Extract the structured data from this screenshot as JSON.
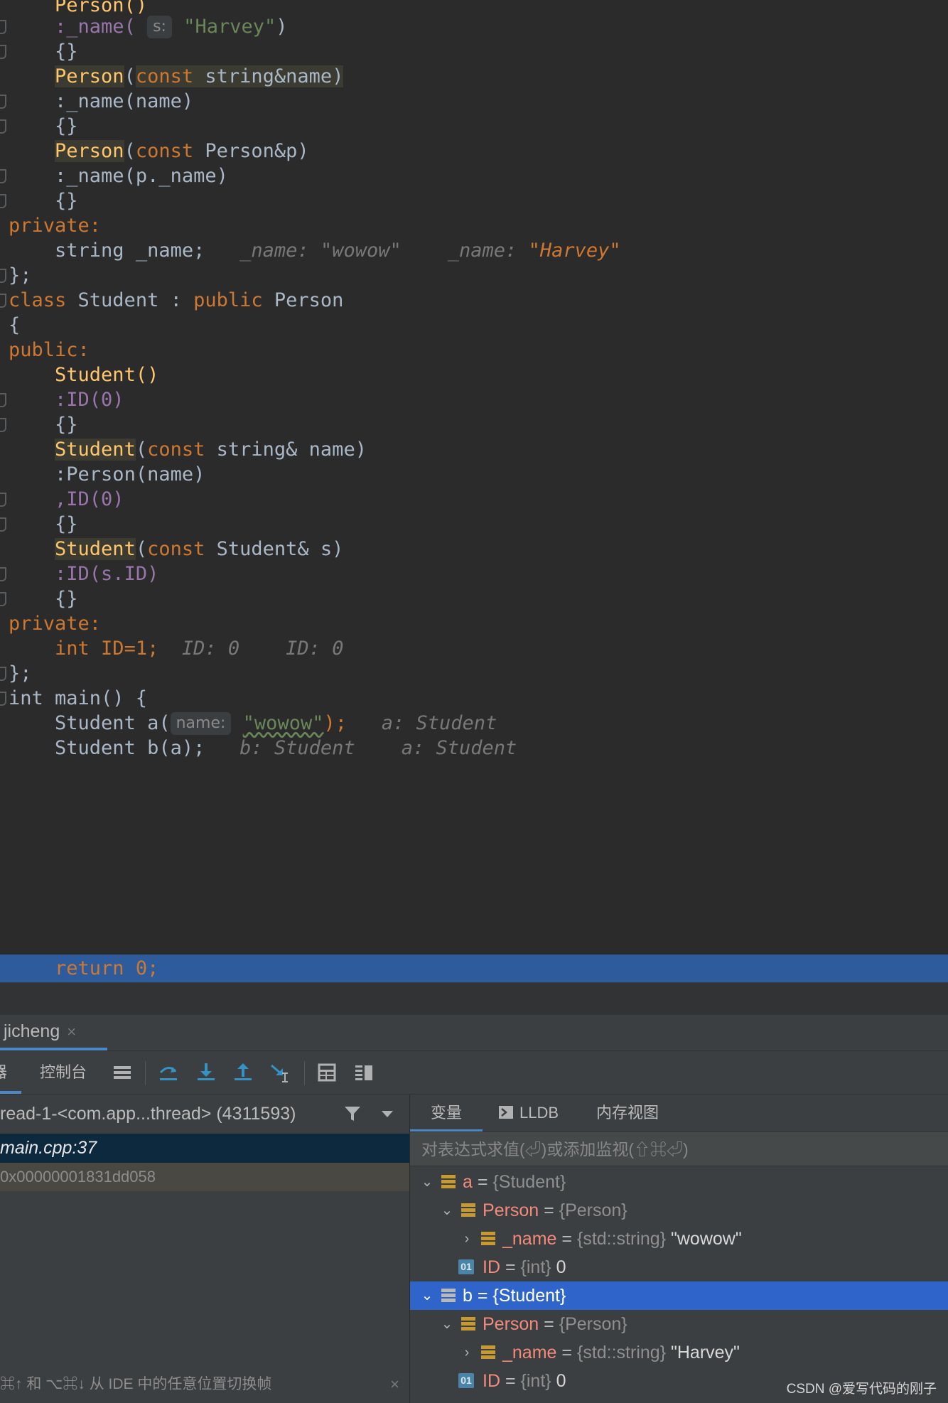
{
  "editor": {
    "l1": "Person()",
    "l2_pre": ":_name(",
    "l2_hint": "s:",
    "l2_str": "\"Harvey\"",
    "l2_post": ")",
    "braces": "{}",
    "l4_fn": "Person",
    "l4_rest_kw": "const",
    "l4_rest": " string&name)",
    "l5": ":_name(name)",
    "l7_fn": "Person",
    "l7_kw": "const",
    "l7_rest": " Person&p)",
    "l8": ":_name(p._name)",
    "private_label": "private:",
    "l11_code": "string _name;",
    "l11_inl1_label": "_name:",
    "l11_inl1_val": "\"wowow\"",
    "l11_inl2_label": "_name:",
    "l11_inl2_val": "\"Harvey\"",
    "close_class": "};",
    "l13_kw1": "class",
    "l13_name": " Student : ",
    "l13_kw2": "public",
    "l13_base": " Person",
    "l14": "{",
    "public_label": "public:",
    "l16": "Student()",
    "l17": ":ID(0)",
    "l19_fn": "Student",
    "l19_kw": "const",
    "l19_rest": " string& name)",
    "l20": ":Person(name)",
    "l21": ",ID(0)",
    "l23_fn": "Student",
    "l23_kw": "const",
    "l23_rest": " Student& s)",
    "l24": ":ID(s.ID)",
    "l27_code": "int ID=1;",
    "l27_inl1": "ID: 0",
    "l27_inl2": "ID: 0",
    "l29": "int main() {",
    "l30_pre": "Student a(",
    "l30_hint": "name:",
    "l30_str": "\"wowow\"",
    "l30_post": ");",
    "l30_inl": "a: Student",
    "l31_code": "Student b(a);",
    "l31_inl1": "b: Student",
    "l31_inl2": "a: Student",
    "l32": "return 0;"
  },
  "debug_tab": {
    "label": "jicheng",
    "close": "×"
  },
  "toolbar": {
    "left_label": "器",
    "console_label": "控制台"
  },
  "frames": {
    "thread": "read-1-<com.app...thread> (4311593)",
    "frame1": "main.cpp:37",
    "frame2": "0x00000001831dd058",
    "hint": "⌘↑ 和 ⌥⌘↓ 从 IDE 中的任意位置切换帧",
    "hint_close": "×"
  },
  "vars_panel": {
    "tabs": [
      "变量",
      "LLDB",
      "内存视图"
    ],
    "eval_placeholder": "对表达式求值(⏎)或添加监视(⇧⌘⏎)",
    "rows": [
      {
        "name": "a",
        "type": "{Student}",
        "value": ""
      },
      {
        "name": "Person",
        "type": "{Person}",
        "value": ""
      },
      {
        "name": "_name",
        "type": "{std::string}",
        "value": "\"wowow\""
      },
      {
        "name": "ID",
        "type": "{int}",
        "value": "0"
      },
      {
        "name": "b",
        "type": "{Student}",
        "value": ""
      },
      {
        "name": "Person",
        "type": "{Person}",
        "value": ""
      },
      {
        "name": "_name",
        "type": "{std::string}",
        "value": "\"Harvey\""
      },
      {
        "name": "ID",
        "type": "{int}",
        "value": "0"
      }
    ],
    "eq": "="
  },
  "watermark": "CSDN @爱写代码的刚子",
  "colors": {
    "selection": "#2f65ca",
    "exec_line": "#2d5b9b",
    "accent": "#4a88c7"
  }
}
